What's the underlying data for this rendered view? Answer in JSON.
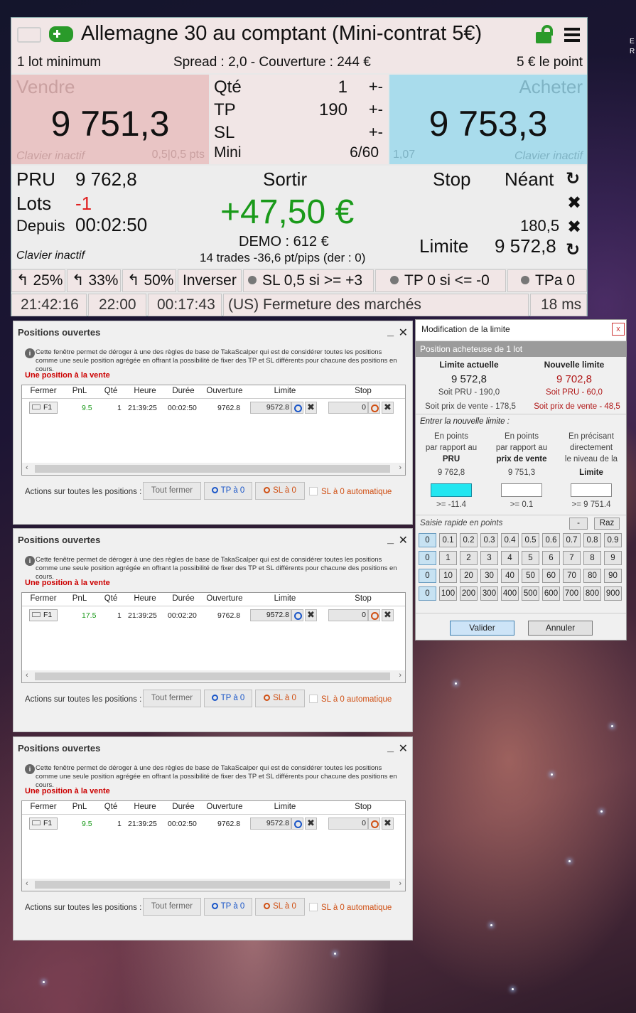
{
  "main": {
    "title": "Allemagne 30 au comptant (Mini-contrat 5€)",
    "min_lot": "1 lot minimum",
    "spread_info": "Spread : 2,0 - Couverture : 244 €",
    "point_value": "5 € le point",
    "sell": {
      "label": "Vendre",
      "price": "9 751,3",
      "keyboard": "Clavier inactif",
      "pts": "0,5|0,5 pts"
    },
    "buy": {
      "label": "Acheter",
      "price": "9 753,3",
      "keyboard": "Clavier inactif",
      "small": "1,07"
    },
    "qty": {
      "qte_label": "Qté",
      "qte_val": "1",
      "tp_label": "TP",
      "tp_val": "190",
      "sl_label": "SL",
      "sl_val": "",
      "mini_label": "Mini",
      "mini_val": "6/60",
      "pm": "+-"
    },
    "position": {
      "pru_label": "PRU",
      "pru_val": "9 762,8",
      "lots_label": "Lots",
      "lots_val": "-1",
      "since_label": "Depuis",
      "since_val": "00:02:50",
      "keyboard": "Clavier inactif",
      "exit_label": "Sortir",
      "pnl": "+47,50 €",
      "demo": "DEMO : 612 €",
      "trades": "14 trades -36,6 pt/pips (der : 0)",
      "stop_label": "Stop",
      "stop_val": "Néant",
      "stop_dist": "180,5",
      "limit_label": "Limite",
      "limit_val": "9 572,8"
    },
    "buttons": [
      "25%",
      "33%",
      "50%",
      "Inverser",
      "SL 0,5 si >= +3",
      "TP 0 si <= -0",
      "TPa 0"
    ],
    "status": {
      "time": "21:42:16",
      "close": "22:00",
      "remaining": "00:17:43",
      "market": "(US)  Fermeture des marchés",
      "latency": "18 ms"
    }
  },
  "positions_windows": [
    {
      "title": "Positions ouvertes",
      "desc": "Cette fenêtre permet de déroger à une des règles de base de TakaScalper qui est de considérer toutes les positions comme une seule position agrégée en offrant la possibilité de fixer des TP et SL différents pour chacune des positions en cours.",
      "label": "Une position à la vente",
      "headers": [
        "Fermer",
        "PnL",
        "Qté",
        "Heure",
        "Durée",
        "Ouverture",
        "Limite",
        "Stop"
      ],
      "row": {
        "close": "F1",
        "pnl": "9.5",
        "qty": "1",
        "time": "21:39:25",
        "duration": "00:02:50",
        "open": "9762.8",
        "limit": "9572.8",
        "stop": "0"
      },
      "actions_label": "Actions sur toutes les positions :",
      "close_all": "Tout fermer",
      "tp0": "TP à 0",
      "sl0": "SL à 0",
      "auto": "SL à 0 automatique"
    },
    {
      "title": "Positions ouvertes",
      "desc": "Cette fenêtre permet de déroger à une des règles de base de TakaScalper qui est de considérer toutes les positions comme une seule position agrégée en offrant la possibilité de fixer des TP et SL différents pour chacune des positions en cours.",
      "label": "Une position à la vente",
      "headers": [
        "Fermer",
        "PnL",
        "Qté",
        "Heure",
        "Durée",
        "Ouverture",
        "Limite",
        "Stop"
      ],
      "row": {
        "close": "F1",
        "pnl": "17.5",
        "qty": "1",
        "time": "21:39:25",
        "duration": "00:02:20",
        "open": "9762.8",
        "limit": "9572.8",
        "stop": "0"
      },
      "actions_label": "Actions sur toutes les positions :",
      "close_all": "Tout fermer",
      "tp0": "TP à 0",
      "sl0": "SL à 0",
      "auto": "SL à 0 automatique"
    },
    {
      "title": "Positions ouvertes",
      "desc": "Cette fenêtre permet de déroger à une des règles de base de TakaScalper qui est de considérer toutes les positions comme une seule position agrégée en offrant la possibilité de fixer des TP et SL différents pour chacune des positions en cours.",
      "label": "Une position à la vente",
      "headers": [
        "Fermer",
        "PnL",
        "Qté",
        "Heure",
        "Durée",
        "Ouverture",
        "Limite",
        "Stop"
      ],
      "row": {
        "close": "F1",
        "pnl": "9.5",
        "qty": "1",
        "time": "21:39:25",
        "duration": "00:02:50",
        "open": "9762.8",
        "limit": "9572.8",
        "stop": "0"
      },
      "actions_label": "Actions sur toutes les positions :",
      "close_all": "Tout fermer",
      "tp0": "TP à 0",
      "sl0": "SL à 0",
      "auto": "SL à 0 automatique"
    }
  ],
  "limit_dialog": {
    "title": "Modification de la limite",
    "close": "x",
    "bar": "Position acheteuse de 1 lot",
    "current_label": "Limite actuelle",
    "current_val": "9 572,8",
    "current_pru": "Soit PRU - 190,0",
    "current_sale": "Soit prix de vente - 178,5",
    "new_label": "Nouvelle limite",
    "new_val": "9 702,8",
    "new_pru": "Soit PRU - 60,0",
    "new_sale": "Soit prix de vente - 48,5",
    "enter": "Entrer la nouvelle limite :",
    "col1": [
      "En points",
      "par rapport au",
      "PRU",
      "9 762,8",
      ">= -11.4"
    ],
    "col2": [
      "En points",
      "par rapport au",
      "prix de vente",
      "9 751,3",
      ">= 0.1"
    ],
    "col3": [
      "En précisant",
      "directement",
      "le niveau de la",
      "Limite",
      ">= 9 751.4"
    ],
    "quick": "Saisie rapide en points",
    "minus": "-",
    "reset": "Raz",
    "keys": [
      [
        "0",
        "0.1",
        "0.2",
        "0.3",
        "0.4",
        "0.5",
        "0.6",
        "0.7",
        "0.8",
        "0.9"
      ],
      [
        "0",
        "1",
        "2",
        "3",
        "4",
        "5",
        "6",
        "7",
        "8",
        "9"
      ],
      [
        "0",
        "10",
        "20",
        "30",
        "40",
        "50",
        "60",
        "70",
        "80",
        "90"
      ],
      [
        "0",
        "100",
        "200",
        "300",
        "400",
        "500",
        "600",
        "700",
        "800",
        "900"
      ]
    ],
    "ok": "Valider",
    "cancel": "Annuler"
  },
  "corner": {
    "l1": "E",
    "l2": "R"
  },
  "colors": {
    "sell_bg": "#e9c5c5",
    "buy_bg": "#a9dcec",
    "pnl": "#1a9a1a",
    "loss": "#e02020",
    "accent_blue": "#1a56c8",
    "accent_orange": "#d05014"
  }
}
